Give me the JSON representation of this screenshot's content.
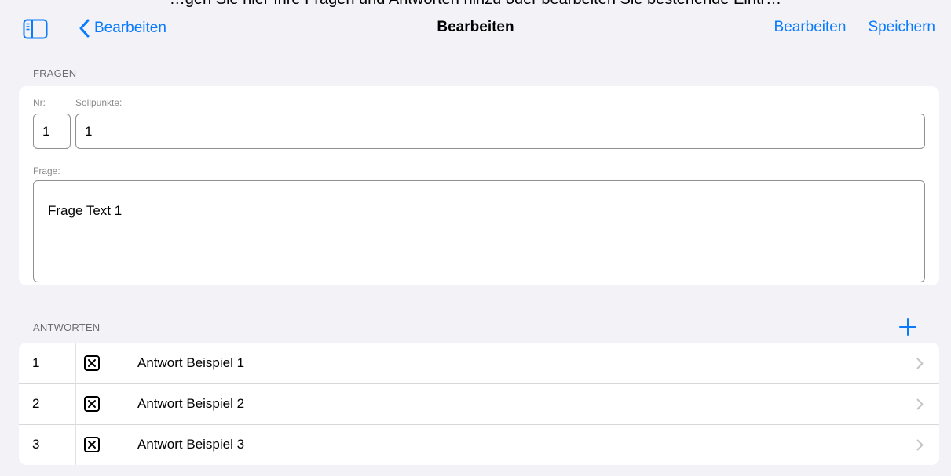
{
  "cut_off_title": "…gen Sie hier Ihre Fragen und Antworten hinzu oder bearbeiten Sie bestehende Eintr…",
  "nav": {
    "back_label": "Bearbeiten",
    "title": "Bearbeiten",
    "edit_label": "Bearbeiten",
    "save_label": "Speichern",
    "accent": "#0a7aff"
  },
  "fragen": {
    "section_title": "FRAGEN",
    "nr_label": "Nr:",
    "sollpunkte_label": "Sollpunkte:",
    "nr_value": "1",
    "sollpunkte_value": "1",
    "frage_label": "Frage:",
    "frage_value": "Frage Text 1"
  },
  "antworten": {
    "section_title": "ANTWORTEN",
    "add_icon": "plus-icon",
    "rows": [
      {
        "num": "1",
        "checked": true,
        "text": "Antwort Beispiel 1"
      },
      {
        "num": "2",
        "checked": true,
        "text": "Antwort Beispiel 2"
      },
      {
        "num": "3",
        "checked": true,
        "text": "Antwort Beispiel 3"
      }
    ]
  }
}
